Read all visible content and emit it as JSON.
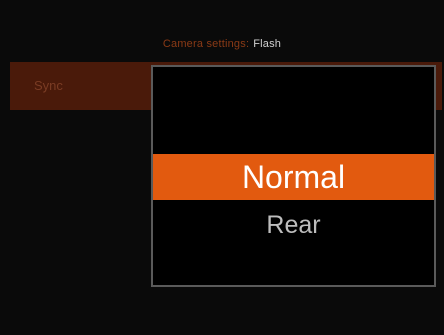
{
  "header": {
    "breadcrumb_prefix": "Camera settings:",
    "breadcrumb_current": "Flash"
  },
  "setting": {
    "label": "Sync"
  },
  "dropdown": {
    "options": [
      {
        "label": "Normal",
        "selected": true
      },
      {
        "label": "Rear",
        "selected": false
      }
    ]
  },
  "colors": {
    "accent": "#e25a0f",
    "row_highlight": "#4a1a0a",
    "background": "#000000"
  }
}
